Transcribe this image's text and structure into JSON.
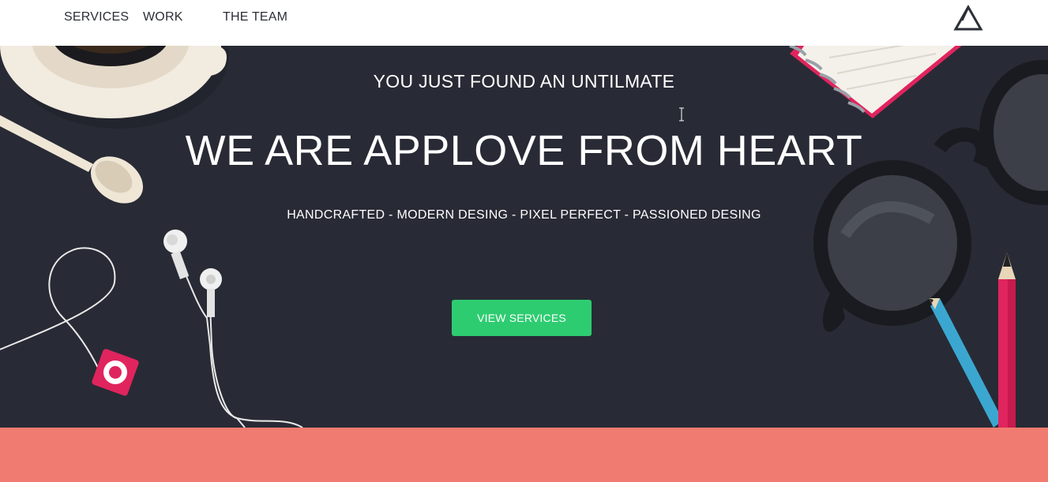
{
  "nav": {
    "items": [
      {
        "label": "SERVICES"
      },
      {
        "label": "WORK"
      },
      {
        "label": "THE TEAM"
      }
    ],
    "logo_icon": "triangle-logo-icon"
  },
  "hero": {
    "tagline": "YOU JUST FOUND AN UNTILMATE",
    "headline": "WE ARE APPLOVE FROM HEART",
    "subline": "HANDCRAFTED - MODERN DESING - PIXEL PERFECT - PASSIONED DESING",
    "cta_label": "VIEW SERVICES"
  },
  "colors": {
    "hero_bg": "#282b35",
    "accent_green": "#2ecc71",
    "coral": "#f07b70",
    "nav_text": "#2b2e36"
  }
}
